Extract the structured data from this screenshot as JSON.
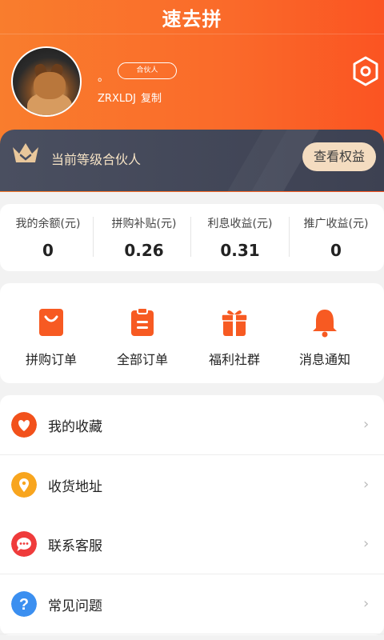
{
  "app": {
    "title": "速去拼"
  },
  "profile": {
    "nickname": "。",
    "badge": "合伙人",
    "user_id": "ZRXLDJ",
    "copy_label": "复制"
  },
  "level": {
    "text": "当前等级合伙人",
    "button": "查看权益"
  },
  "stats": [
    {
      "label": "我的余额(元)",
      "value": "0"
    },
    {
      "label": "拼购补贴(元)",
      "value": "0.26"
    },
    {
      "label": "利息收益(元)",
      "value": "0.31"
    },
    {
      "label": "推广收益(元)",
      "value": "0"
    }
  ],
  "orders": [
    {
      "label": "拼购订单",
      "icon": "shopping-bag-icon"
    },
    {
      "label": "全部订单",
      "icon": "clipboard-icon"
    },
    {
      "label": "福利社群",
      "icon": "gift-icon"
    },
    {
      "label": "消息通知",
      "icon": "bell-icon"
    }
  ],
  "menu": [
    {
      "label": "我的收藏",
      "icon": "heart-icon",
      "color": "#f2511b"
    },
    {
      "label": "收货地址",
      "icon": "location-pin-icon",
      "color": "#f8a51e"
    },
    {
      "label": "联系客服",
      "icon": "chat-icon",
      "color": "#ef3b3b"
    },
    {
      "label": "常见问题",
      "icon": "question-icon",
      "color": "#3b8ff0"
    }
  ],
  "colors": {
    "accent": "#fa6a2a",
    "level_bg": "#464a5b",
    "gold": "#f4dcc0"
  }
}
